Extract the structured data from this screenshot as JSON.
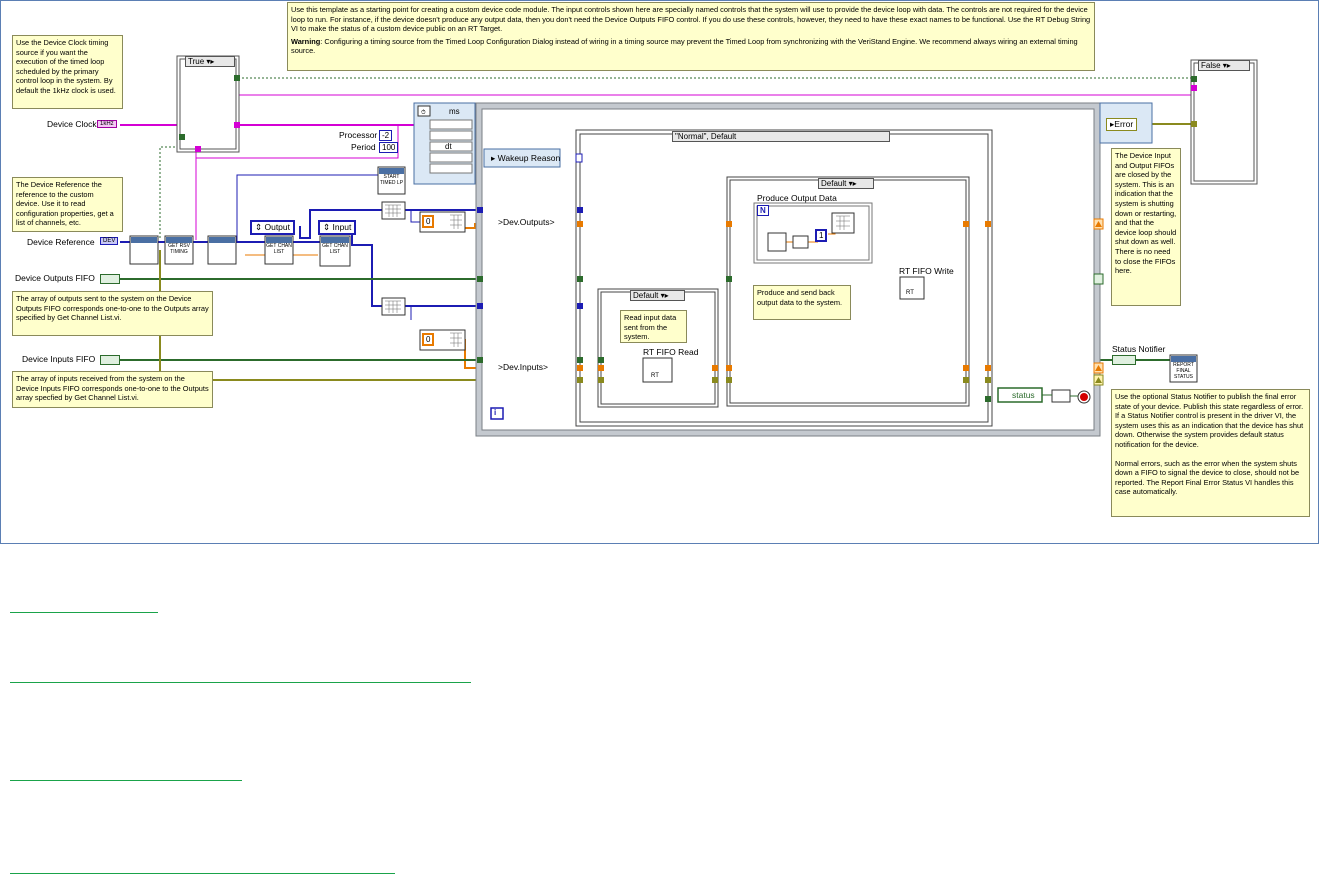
{
  "notes": {
    "top": "Use this template as a starting point for creating a custom device code module. The input controls shown here are specially named controls that the system will use to provide the device loop with data. The controls are not required for the device loop to run. For instance, if the device doesn't produce any output data, then you don't need the Device Outputs FIFO control. If you do use these controls, however, they need to have these exact names to be functional. Use the RT Debug String VI to make the status of a custom device public on an RT Target.",
    "warning_label": "Warning",
    "warning": ": Configuring a timing source from the Timed Loop Configuration Dialog instead of wiring in a timing source may prevent the Timed Loop from synchronizing with the VeriStand Engine. We recommend always wiring an external timing source.",
    "clock": "Use the Device Clock timing source if you want the execution of the timed loop scheduled by the primary control loop in the system. By default the 1kHz clock is used.",
    "reference": "The Device Reference the reference to the custom device. Use it to read configuration properties, get a list of channels, etc.",
    "outputs": "The array of outputs sent to the system on the Device Outputs FIFO corresponds one-to-one to the Outputs array specified by Get Channel List.vi.",
    "inputs": "The array of inputs  received from the system on the Device Inputs FIFO corresponds one-to-one to the Outputs array specfied by Get Channel List.vi.",
    "fifos_closed": "The Device Input and Output FIFOs are closed by the system. This is an indication that the system is shutting down or restarting, and that the device loop should shut down as well. There is no need to close the FIFOs here.",
    "status": "Use the optional Status Notifier to publish the final error state of your device. Publish this state regardless of error. If a Status Notifier control is present in the driver VI, the system uses this as an indication that the device has shut down. Otherwise the system provides default status notification for the device.",
    "status2": "Normal errors, such as the error when the system shuts down a FIFO to signal the device to close, should not be reported. The Report Final Error Status VI handles this case automatically.",
    "read_input": "Read input data sent from the system.",
    "produce": "Produce and send back output data to the system."
  },
  "labels": {
    "device_clock": "Device Clock",
    "device_reference": "Device Reference",
    "device_outputs_fifo": "Device Outputs FIFO",
    "device_inputs_fifo": "Device Inputs FIFO",
    "processor": "Processor",
    "period": "Period",
    "processor_val": "-2",
    "period_val": "100",
    "ms": "ms",
    "dt": "dt",
    "wakeup": "Wakeup Reason",
    "dev_outputs": ">Dev.Outputs>",
    "dev_inputs": ">Dev.Inputs>",
    "produce_output": "Produce Output Data",
    "rt_fifo_write": "RT FIFO Write",
    "rt_fifo_read": "RT FIFO Read",
    "rt": "RT",
    "status_notifier": "Status Notifier",
    "status": "status",
    "error": "Error",
    "output_ring": "Output",
    "input_ring": "Input",
    "zero": "0",
    "one": "1",
    "n": "N",
    "i": "i",
    "clock_ctl": "1kHz",
    "ref_ctl": "DEV",
    "get_chan_list": "GET CHAN LIST",
    "get_rsv_timing": "GET RSV TIMING",
    "report_final_status": "REPORT FINAL STATUS",
    "start_timed_loop": "START TIMED LP"
  },
  "case_selectors": {
    "true_case": "True",
    "false_case": "False",
    "normal_default": "\"Normal\", Default",
    "default1": "Default",
    "default2": "Default"
  },
  "colors": {
    "orange_wire": "#e87a00",
    "pink_wire": "#d400d4",
    "blue_wire": "#1c1cb3",
    "green_wire": "#2c6b2c",
    "olive_wire": "#8a8a1e",
    "note_bg": "#ffffcc",
    "link": "#1aa34a"
  }
}
